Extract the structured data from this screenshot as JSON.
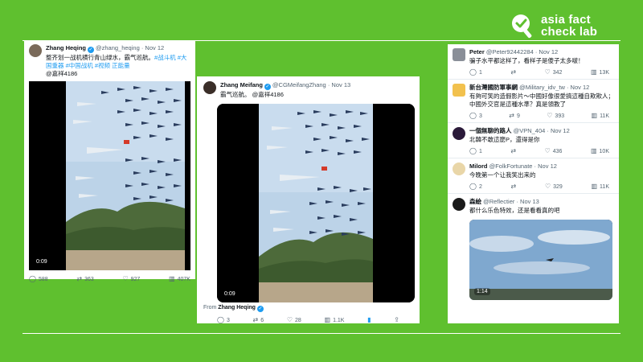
{
  "brand": {
    "line1": "asia fact",
    "line2": "check lab"
  },
  "colors": {
    "background": "#5fc02f",
    "link": "#1d9bf0",
    "muted": "#536471"
  },
  "tweet1": {
    "name": "Zhang Heqing",
    "handle": "@zhang_heqing · Nov 12",
    "text": "整齐划一战机横行青山绿水，霸气巡航。",
    "tags": "#战斗机 #大国重器 #中国战机 #视频 正能量",
    "mention": "@嘉祥4186",
    "video_time": "0:09",
    "stats": {
      "replies": "588",
      "reposts": "363",
      "likes": "927",
      "views": "407K"
    }
  },
  "tweet2": {
    "name": "Zhang Meifang",
    "handle": "@CGMeifangZhang · Nov 13",
    "text": "霸气巡航。 @嘉祥4186",
    "video_time": "0:09",
    "from_label": "From",
    "from_name": "Zhang Heqing",
    "stats": {
      "replies": "3",
      "reposts": "6",
      "likes": "28",
      "views": "1.1K"
    }
  },
  "replies": [
    {
      "name": "Peter",
      "handle": "@Peter92442284 · Nov 12",
      "text": "骗子水平都这样了，看样子是傻子太多啵！",
      "stats": {
        "replies": "1",
        "reposts": "",
        "likes": "342",
        "views": "13K"
      }
    },
    {
      "name": "新台灣國防軍事網",
      "handle": "@Military_idv_tw · Nov 12",
      "text": "有夠可笑的造假影片～中國好像很愛搞這種自欺欺人；中國外交官是這種水準？真是領教了",
      "stats": {
        "replies": "3",
        "reposts": "9",
        "likes": "393",
        "views": "11K"
      }
    },
    {
      "name": "一個無聊的路人",
      "handle": "@VPN_404 · Nov 12",
      "text": "北韓不敢這麼P，還得是你",
      "stats": {
        "replies": "1",
        "reposts": "",
        "likes": "436",
        "views": "10K"
      }
    },
    {
      "name": "Milord",
      "handle": "@FolkFortunate · Nov 12",
      "text": "今晚第一个让我笑出来的",
      "stats": {
        "replies": "2",
        "reposts": "",
        "likes": "329",
        "views": "11K"
      }
    },
    {
      "name": "森絵",
      "handle": "@Reflectier · Nov 13",
      "text": "都什么乐色特效，还是看看真的吧",
      "video_time": "1:14"
    }
  ]
}
